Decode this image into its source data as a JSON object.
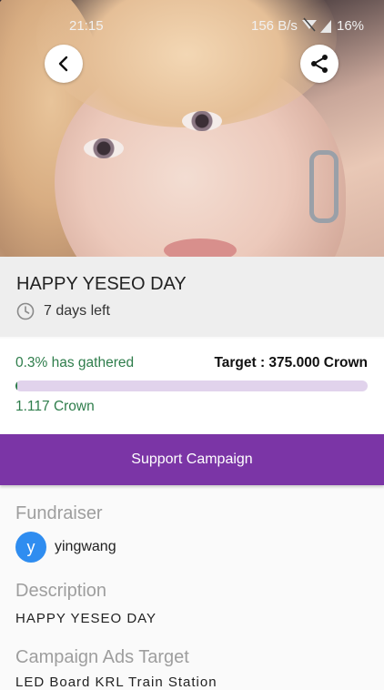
{
  "status_bar": {
    "time": "21:15",
    "network_speed": "156 B/s",
    "battery": "16%"
  },
  "hero": {
    "back_icon": "chevron-left-icon",
    "share_icon": "share-icon"
  },
  "campaign": {
    "title": "HAPPY YESEO DAY",
    "days_left": "7 days left",
    "clock_icon": "clock-icon"
  },
  "progress": {
    "gathered_label": "0.3% has gathered",
    "target_label": "Target : 375.000 Crown",
    "raised_label": "1.117 Crown",
    "fraction": 0.003,
    "fill_color": "#2e7d4b",
    "track_color": "#e1d3ec"
  },
  "support_button": {
    "label": "Support Campaign",
    "color": "#7b35a6"
  },
  "details": {
    "fundraiser_heading": "Fundraiser",
    "fundraiser_initial": "y",
    "fundraiser_name": "yingwang",
    "description_heading": "Description",
    "description_text": "HAPPY YESEO DAY",
    "ads_heading": "Campaign Ads Target",
    "ads_text": "LED Board KRL Train Station"
  }
}
